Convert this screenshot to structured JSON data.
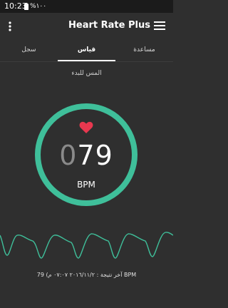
{
  "status_bar": {
    "time": "10:23",
    "battery": "%١٠٠",
    "battery_icon": "battery-full-icon"
  },
  "app_bar": {
    "title": "Heart Rate Plus",
    "overflow_icon": "more-vert-icon",
    "menu_icon": "hamburger-menu-icon"
  },
  "tabs": [
    {
      "label": "سجل",
      "active": false
    },
    {
      "label": "قياس",
      "active": true
    },
    {
      "label": "مساعدة",
      "active": false
    }
  ],
  "measure": {
    "instruction": "المس للبدء",
    "bpm_prefix": "0",
    "bpm_value": "79",
    "bpm_unit": "BPM",
    "last_result": "آخر نتيجة : ٢٠١٦/١١/٢ ٠٧:٠٧ م) 79 BPM"
  },
  "colors": {
    "background": "#2f2f2f",
    "accent_green": "#3fbf9a",
    "heart_red": "#e8384f"
  }
}
